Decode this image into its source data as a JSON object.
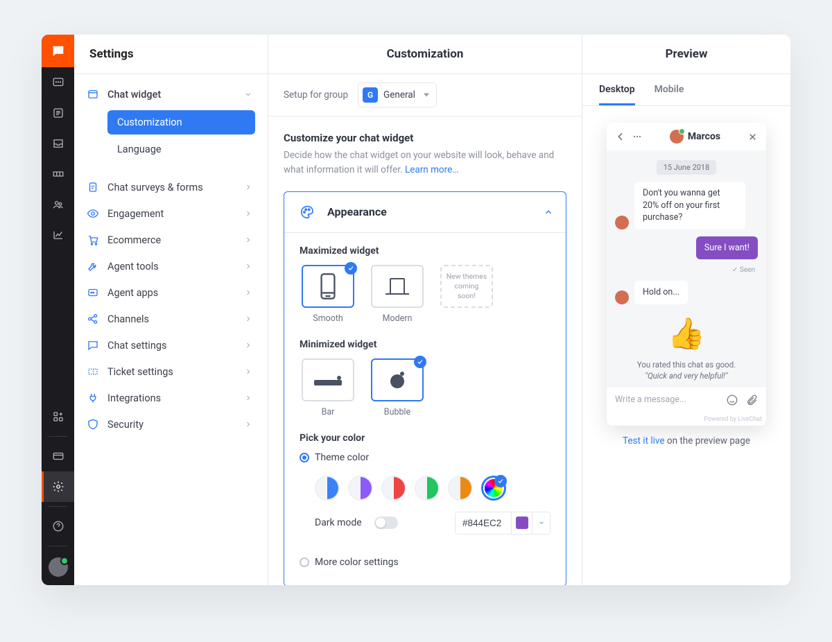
{
  "settings_title": "Settings",
  "sidebar": {
    "group": {
      "label": "Chat widget"
    },
    "sub": [
      {
        "label": "Customization",
        "active": true
      },
      {
        "label": "Language",
        "active": false
      }
    ],
    "items": [
      {
        "icon": "clipboard",
        "label": "Chat surveys & forms"
      },
      {
        "icon": "eye",
        "label": "Engagement"
      },
      {
        "icon": "cart",
        "label": "Ecommerce"
      },
      {
        "icon": "wrench",
        "label": "Agent tools"
      },
      {
        "icon": "apps",
        "label": "Agent apps"
      },
      {
        "icon": "share",
        "label": "Channels"
      },
      {
        "icon": "chat",
        "label": "Chat settings"
      },
      {
        "icon": "ticket",
        "label": "Ticket settings"
      },
      {
        "icon": "plug",
        "label": "Integrations"
      },
      {
        "icon": "shield",
        "label": "Security"
      }
    ]
  },
  "main": {
    "title": "Customization",
    "group_label": "Setup for group",
    "group_badge": "G",
    "group_value": "General",
    "section_heading": "Customize your chat widget",
    "section_desc": "Decide how the chat widget on your website will look, behave and what information it will offer. ",
    "learn_more": "Learn more…",
    "appearance": {
      "title": "Appearance",
      "max_label": "Maximized widget",
      "max_options": [
        {
          "key": "smooth",
          "label": "Smooth",
          "selected": true
        },
        {
          "key": "modern",
          "label": "Modern",
          "selected": false
        }
      ],
      "coming": "New themes coming soon!",
      "min_label": "Minimized widget",
      "min_options": [
        {
          "key": "bar",
          "label": "Bar",
          "selected": false
        },
        {
          "key": "bubble",
          "label": "Bubble",
          "selected": true
        }
      ],
      "pick_label": "Pick your color",
      "theme_radio": "Theme color",
      "more_radio": "More color settings",
      "swatches": [
        {
          "color": "#3b82f6"
        },
        {
          "color": "#8b5cf6"
        },
        {
          "color": "#ef4444"
        },
        {
          "color": "#22c55e"
        },
        {
          "color": "#ea8a12"
        }
      ],
      "dark_label": "Dark mode",
      "hex": "#844EC2"
    }
  },
  "preview": {
    "title": "Preview",
    "tabs": {
      "desktop": "Desktop",
      "mobile": "Mobile"
    },
    "agent": "Marcos",
    "date": "15 June 2018",
    "msg_in1": "Don't you wanna get 20% off on your first purchase?",
    "msg_out1": "Sure I want!",
    "seen": "✓ Seen",
    "msg_in2": "Hold on...",
    "thumb": "👍",
    "rated": "You rated this chat as good.",
    "rated_quote": "\"Quick and very helpful!\"",
    "placeholder": "Write a message...",
    "powered": "Powered by LiveChat",
    "test_link": "Test it live",
    "test_rest": " on the preview page"
  }
}
